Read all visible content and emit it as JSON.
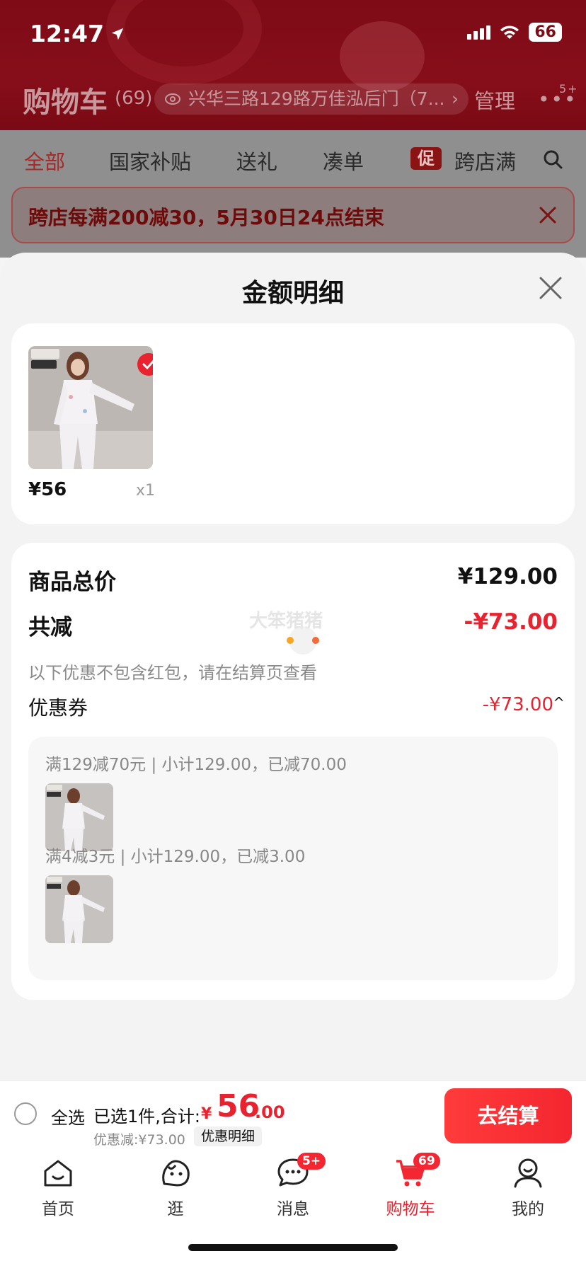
{
  "status_bar": {
    "time": "12:47",
    "battery": "66"
  },
  "cart_header": {
    "title": "购物车",
    "count": "(69)",
    "address": "兴华三路129路万佳泓后门（7...",
    "manage": "管理",
    "more_badge": "5+"
  },
  "tabs": [
    {
      "label": "全部"
    },
    {
      "label": "国家补贴"
    },
    {
      "label": "送礼"
    },
    {
      "label": "凑单"
    },
    {
      "label": "跨店满减"
    }
  ],
  "promo_badge": "促",
  "banner": {
    "text": "跨店每满200减30，5月30日24点结束"
  },
  "sheet": {
    "title": "金额明细",
    "product": {
      "price": "¥56",
      "qty": "x1"
    },
    "summary": {
      "total_label": "商品总价",
      "total_value": "¥129.00",
      "reduce_label": "共减",
      "reduce_value": "-¥73.00",
      "note": "以下优惠不包含红包，请在结算页查看",
      "coupon_label": "优惠券",
      "coupon_value": "-¥73.00"
    },
    "coupon_rules": [
      {
        "text": "满129减70元 | 小计129.00，已减70.00"
      },
      {
        "text": "满4减3元 | 小计129.00，已减3.00"
      }
    ],
    "watermark": "大笨猪猪"
  },
  "checkout": {
    "select_all": "全选",
    "selected_text": "已选1件,合计:",
    "currency": "¥",
    "total_int": "56",
    "total_dec": ".00",
    "discount_text": "优惠减:¥73.00",
    "detail_label": "优惠明细",
    "pay_label": "去结算"
  },
  "nav": {
    "items": [
      {
        "label": "首页",
        "icon": "home-icon"
      },
      {
        "label": "逛",
        "icon": "browse-icon"
      },
      {
        "label": "消息",
        "icon": "message-icon",
        "badge": "5+"
      },
      {
        "label": "购物车",
        "icon": "cart-icon",
        "badge": "69"
      },
      {
        "label": "我的",
        "icon": "profile-icon"
      }
    ],
    "active": "购物车"
  },
  "colors": {
    "accent": "#e8222e",
    "header_bg": "#7e0b16"
  }
}
